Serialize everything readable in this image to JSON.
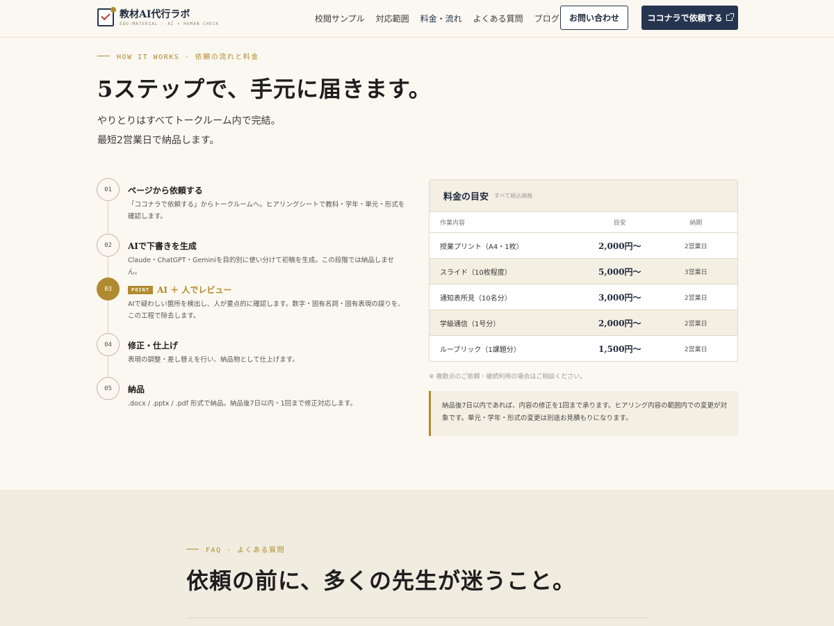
{
  "header": {
    "logo_title": "教材AI代行ラボ",
    "logo_sub": "EDU-MATERIAL · AI × HUMAN CHECK",
    "nav": [
      "校閲サンプル",
      "対応範囲",
      "料金・流れ",
      "よくある質問",
      "ブログ"
    ],
    "active_nav": "料金・流れ",
    "contact_label": "お問い合わせ",
    "order_label": "ココナラで依頼する",
    "accent_color": "#26354f",
    "gold_color": "#b08a2e"
  },
  "hero": {
    "eyebrow": "HOW IT WORKS · 依頼の流れと料金",
    "title": "5ステップで、手元に届きます。",
    "desc_line1": "やりとりはすべてトークルーム内で完結。",
    "desc_line2": "最短2営業日で納品します。"
  },
  "steps": [
    {
      "num": "01",
      "title": "ページから依頼する",
      "desc": "「ココナラで依頼する」からトークルームへ。ヒアリングシートで教科・学年・単元・形式を確認します。"
    },
    {
      "num": "02",
      "title": "AIで下書きを生成",
      "desc": "Claude・ChatGPT・Geminiを目的別に使い分けて初稿を生成。この段階では納品しません。"
    },
    {
      "num": "03",
      "badge": "POINT",
      "title": "AI ＋ 人でレビュー",
      "desc": "AIで疑わしい箇所を検出し、人が重点的に確認します。数字・固有名詞・固有表現の誤りを、この工程で除去します。"
    },
    {
      "num": "04",
      "title": "修正・仕上げ",
      "desc": "表現の調整・差し替えを行い、納品物として仕上げます。"
    },
    {
      "num": "05",
      "title": "納品",
      "desc": ".docx / .pptx / .pdf 形式で納品。納品後7日以内・1回まで修正対応します。"
    }
  ],
  "pricing": {
    "title": "料金の目安",
    "note": "すべて税込価格",
    "columns": [
      "作業内容",
      "目安",
      "納期"
    ],
    "rows": [
      {
        "item": "授業プリント（A4・1枚）",
        "price": "2,000円〜",
        "days": "2営業日"
      },
      {
        "item": "スライド（10枚程度）",
        "price": "5,000円〜",
        "days": "3営業日"
      },
      {
        "item": "通知表所見（10名分）",
        "price": "3,000円〜",
        "days": "2営業日"
      },
      {
        "item": "学級通信（1号分）",
        "price": "2,000円〜",
        "days": "2営業日"
      },
      {
        "item": "ルーブリック（1課題分）",
        "price": "1,500円〜",
        "days": "2営業日"
      }
    ],
    "footnote": "※ 複数点のご依頼・継続利用の場合はご相談ください。",
    "notice": "納品後7日以内であれば、内容の修正を1回まで承ります。ヒアリング内容の範囲内での変更が対象です。単元・学年・形式の変更は別途お見積もりになります。"
  },
  "faq": {
    "eyebrow": "FAQ · よくある質問",
    "title": "依頼の前に、多くの先生が迷うこと。"
  }
}
